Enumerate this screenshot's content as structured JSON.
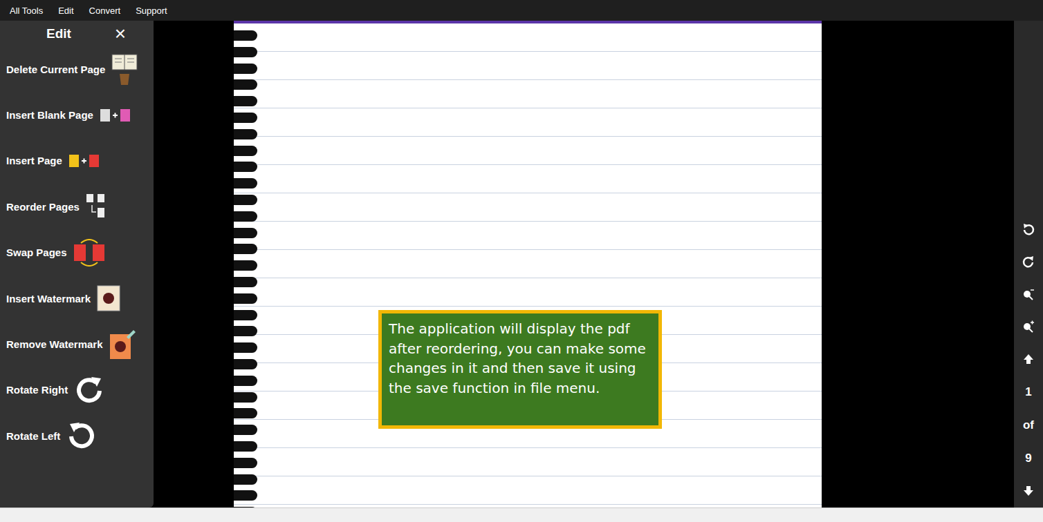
{
  "menu": [
    "All Tools",
    "Edit",
    "Convert",
    "Support"
  ],
  "edit_panel": {
    "title": "Edit",
    "close": "×",
    "items": [
      {
        "label": "Delete Current Page"
      },
      {
        "label": "Insert Blank Page"
      },
      {
        "label": "Insert Page"
      },
      {
        "label": "Reorder Pages"
      },
      {
        "label": "Swap Pages"
      },
      {
        "label": "Insert Watermark"
      },
      {
        "label": "Remove Watermark"
      },
      {
        "label": "Rotate Right"
      },
      {
        "label": "Rotate Left"
      }
    ]
  },
  "viewer": {
    "tooltip": "The application will display the pdf after reordering, you can make some changes in it and then save it using the save function in file menu."
  },
  "page_nav": {
    "current": "1",
    "separator": "of",
    "total": "9"
  }
}
